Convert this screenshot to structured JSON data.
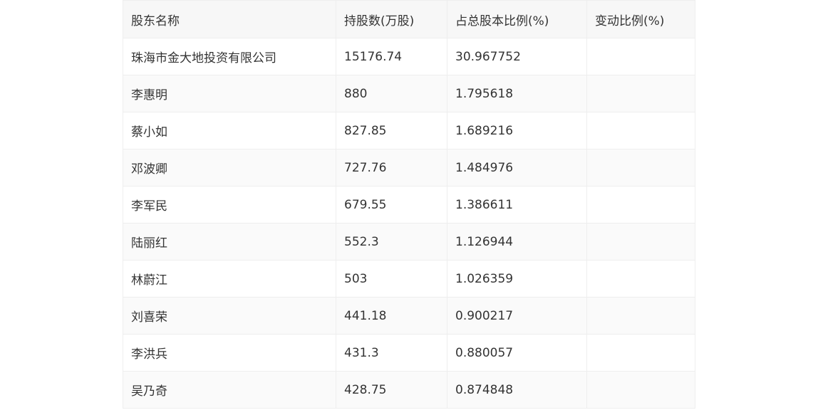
{
  "table": {
    "headers": [
      "股东名称",
      "持股数(万股)",
      "占总股本比例(%)",
      "变动比例(%)"
    ],
    "rows": [
      [
        "珠海市金大地投资有限公司",
        "15176.74",
        "30.967752",
        ""
      ],
      [
        "李惠明",
        "880",
        "1.795618",
        ""
      ],
      [
        "蔡小如",
        "827.85",
        "1.689216",
        ""
      ],
      [
        "邓波卿",
        "727.76",
        "1.484976",
        ""
      ],
      [
        "李军民",
        "679.55",
        "1.386611",
        ""
      ],
      [
        "陆丽红",
        "552.3",
        "1.126944",
        ""
      ],
      [
        "林蔚江",
        "503",
        "1.026359",
        ""
      ],
      [
        "刘喜荣",
        "441.18",
        "0.900217",
        ""
      ],
      [
        "李洪兵",
        "431.3",
        "0.880057",
        ""
      ],
      [
        "吴乃奇",
        "428.75",
        "0.874848",
        ""
      ]
    ]
  }
}
